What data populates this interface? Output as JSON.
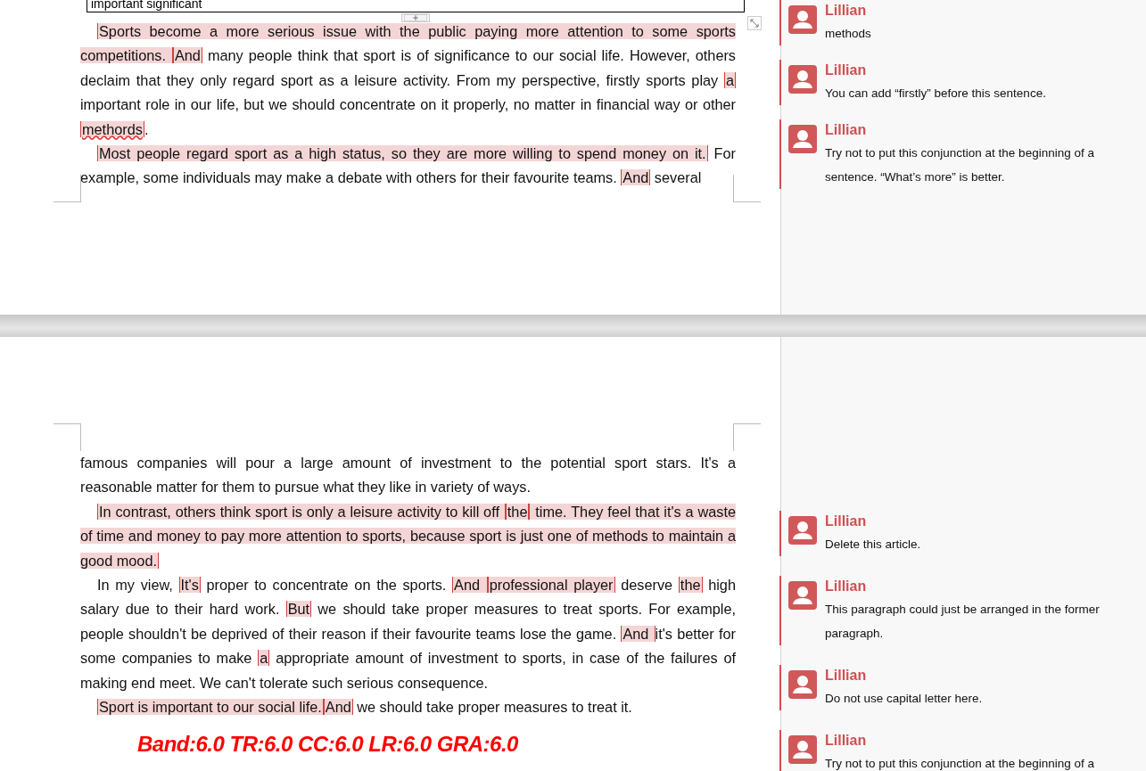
{
  "top_page": {
    "text_box": "important significant",
    "paragraphs": [
      {
        "kind": "indented",
        "segments": [
          {
            "text": "Sports become a more serious issue with the public paying more attention to some sports competitions. ",
            "highlighted": true
          },
          {
            "text": "And",
            "highlighted": true
          },
          {
            "text": " many people think that sport is of significance to our social life. However, others declaim that they only regard sport as a leisure activity. From my perspective, firstly sports play ",
            "highlighted": false
          },
          {
            "text": "a",
            "highlighted": true
          },
          {
            "text": " important role in our life, but we should concentrate on it properly, no matter in financial way or other ",
            "highlighted": false
          },
          {
            "text": "methords",
            "highlighted": true,
            "misspelled": true
          },
          {
            "text": ".",
            "highlighted": false
          }
        ]
      },
      {
        "kind": "indented",
        "segments": [
          {
            "text": "Most people regard sport as a high status, so they are more willing to spend money on it.",
            "highlighted": true
          },
          {
            "text": " For example, some individuals may make a debate with others for their favourite teams. ",
            "highlighted": false
          },
          {
            "text": "And",
            "highlighted": true
          },
          {
            "text": " several",
            "highlighted": false
          }
        ]
      }
    ],
    "comments": [
      {
        "author": "Lillian",
        "text": "methods"
      },
      {
        "author": "Lillian",
        "text": "You can add “firstly” before this sentence."
      },
      {
        "author": "Lillian",
        "text": "Try not to put this conjunction at the beginning of a sentence. “What’s more” is better."
      }
    ]
  },
  "bottom_page": {
    "paragraphs": [
      {
        "kind": "continued",
        "segments": [
          {
            "text": "famous companies will pour a large amount of investment to the potential sport stars. It's a reasonable matter for them to pursue what they like in variety of ways.",
            "highlighted": false
          }
        ]
      },
      {
        "kind": "indented",
        "segments": [
          {
            "text": "In contrast, others think sport is only a leisure activity to kill off ",
            "highlighted": true
          },
          {
            "text": "the",
            "highlighted": true
          },
          {
            "text": " time. They feel that it's a waste of time and money to pay more attention to sports, because sport is just one of methods to maintain a good mood.",
            "highlighted": true
          }
        ]
      },
      {
        "kind": "indented",
        "segments": [
          {
            "text": "In my view, ",
            "highlighted": false
          },
          {
            "text": "It's",
            "highlighted": true
          },
          {
            "text": " proper to concentrate on the sports. ",
            "highlighted": false
          },
          {
            "text": "And ",
            "highlighted": true
          },
          {
            "text": "professional player",
            "highlighted": true
          },
          {
            "text": " deserve ",
            "highlighted": false
          },
          {
            "text": "the",
            "highlighted": true
          },
          {
            "text": " high salary due to their hard work. ",
            "highlighted": false
          },
          {
            "text": "But",
            "highlighted": true
          },
          {
            "text": " we should take proper measures to treat sports. For example, people shouldn't be deprived of their reason if their favourite teams lose the game. ",
            "highlighted": false
          },
          {
            "text": "And ",
            "highlighted": true
          },
          {
            "text": "it's better for some companies to make ",
            "highlighted": false
          },
          {
            "text": "a",
            "highlighted": true
          },
          {
            "text": " appropriate amount of investment to sports, in case of the failures of making end meet. We can't tolerate such serious consequence.",
            "highlighted": false
          }
        ]
      },
      {
        "kind": "indented",
        "segments": [
          {
            "text": "Sport is important to our social life.",
            "highlighted": true
          },
          {
            "text": "And",
            "highlighted": true
          },
          {
            "text": " we should take proper measures to treat it.",
            "highlighted": false
          }
        ]
      }
    ],
    "score": "Band:6.0 TR:6.0 CC:6.0 LR:6.0 GRA:6.0",
    "comments": [
      {
        "author": "Lillian",
        "text": "Delete this article."
      },
      {
        "author": "Lillian",
        "text": "This paragraph could just be arranged in the former paragraph."
      },
      {
        "author": "Lillian",
        "text": "Do not use capital letter here."
      },
      {
        "author": "Lillian",
        "text": "Try not to put this conjunction at the beginning of a"
      }
    ]
  }
}
